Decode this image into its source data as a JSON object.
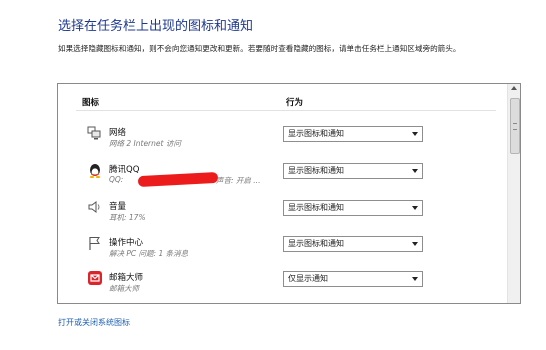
{
  "page": {
    "title": "选择在任务栏上出现的图标和通知",
    "description": "如果选择隐藏图标和通知，则不会向您通知更改和更新。若要随时查看隐藏的图标，请单击任务栏上通知区域旁的箭头。"
  },
  "table": {
    "col_icon": "图标",
    "col_action": "行为",
    "rows": [
      {
        "name": "网络",
        "sub": "网络 2 Internet 访问",
        "sub_extra": "",
        "icon": "network-icon",
        "action": "显示图标和通知"
      },
      {
        "name": "腾讯QQ",
        "sub": "QQ:",
        "sub_extra": "声音: 开启 ...",
        "icon": "qq-penguin-icon",
        "action": "显示图标和通知"
      },
      {
        "name": "音量",
        "sub": "耳机: 17%",
        "sub_extra": "",
        "icon": "speaker-icon",
        "action": "显示图标和通知"
      },
      {
        "name": "操作中心",
        "sub": "解决 PC 问题: 1 条消息",
        "sub_extra": "",
        "icon": "flag-icon",
        "action": "显示图标和通知"
      },
      {
        "name": "邮箱大师",
        "sub": "邮箱大师",
        "sub_extra": "",
        "icon": "mail-master-icon",
        "action": "仅显示通知"
      }
    ]
  },
  "footer": {
    "link": "打开或关闭系统图标"
  }
}
